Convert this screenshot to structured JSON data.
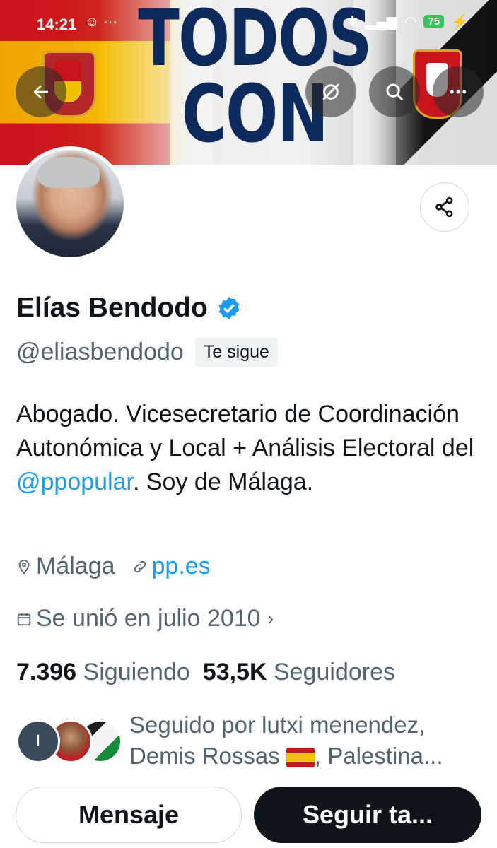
{
  "status_bar": {
    "time": "14:21",
    "notif_icons": "☺ ···",
    "battery": "75"
  },
  "banner": {
    "line1": "TODOS",
    "line2": "CON CEUTA"
  },
  "icons": {
    "back": "arrow-left-icon",
    "grok": "grok-icon",
    "search": "search-icon",
    "more": "more-icon",
    "share": "share-icon",
    "verified": "verified-badge-icon",
    "location": "location-pin-icon",
    "link": "link-icon",
    "calendar": "calendar-icon",
    "chevron": "chevron-right-icon"
  },
  "profile": {
    "name": "Elías Bendodo",
    "handle": "@eliasbendodo",
    "follows_you": "Te sigue",
    "bio_part1": "Abogado. Vicesecretario de Coordinación Autonómica y Local + Análisis Electoral del ",
    "bio_mention": "@ppopular",
    "bio_part2": ". Soy de Málaga.",
    "location": "Málaga",
    "website": "pp.es",
    "joined": "Se unió en julio 2010",
    "following_count": "7.396",
    "following_label": "Siguiendo",
    "followers_count": "53,5K",
    "followers_label": "Seguidores"
  },
  "followed_by": {
    "initial": "I",
    "text_part1": "Seguido por lutxi menendez, Demis Rossas",
    "text_part2": ", Palestina..."
  },
  "actions": {
    "message": "Mensaje",
    "follow": "Seguir ta..."
  },
  "colors": {
    "accent": "#1d9bf0",
    "text_secondary": "#536471",
    "text_primary": "#0f1419"
  }
}
